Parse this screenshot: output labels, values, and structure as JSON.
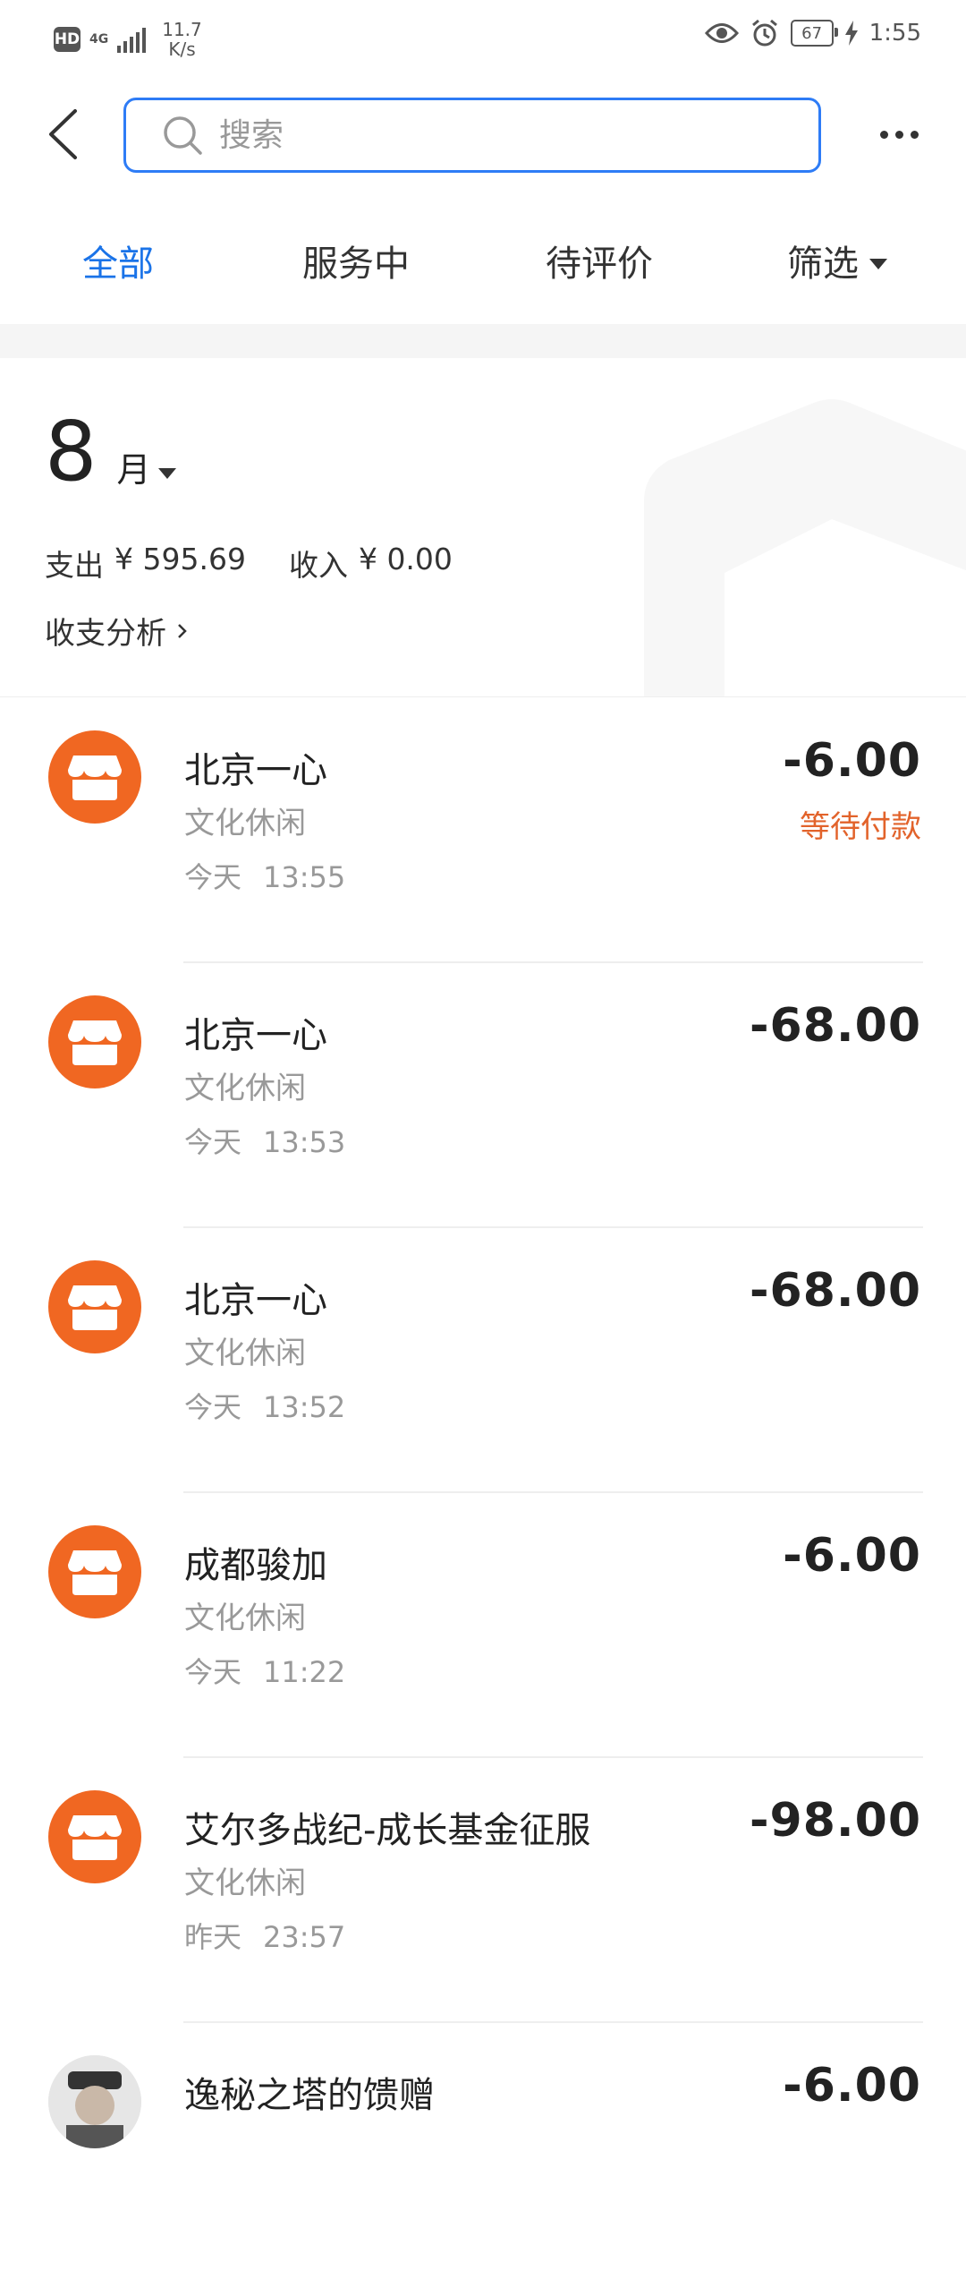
{
  "status_bar": {
    "hd": "HD",
    "network": "4G",
    "speed_value": "11.7",
    "speed_unit": "K/s",
    "battery": "67",
    "time": "1:55"
  },
  "header": {
    "search_placeholder": "搜索"
  },
  "tabs": [
    {
      "label": "全部",
      "active": true
    },
    {
      "label": "服务中",
      "active": false
    },
    {
      "label": "待评价",
      "active": false
    },
    {
      "label": "筛选",
      "active": false
    }
  ],
  "month": {
    "number": "8",
    "unit": "月",
    "expense_label": "支出",
    "expense_value": "¥ 595.69",
    "income_label": "收入",
    "income_value": "¥ 0.00",
    "analysis_label": "收支分析"
  },
  "colors": {
    "accent": "#1a73e8",
    "shop_icon": "#f06722",
    "pending": "#e2632b"
  },
  "transactions": [
    {
      "title": "北京一心",
      "category": "文化休闲",
      "day": "今天",
      "time": "13:55",
      "amount": "-6.00",
      "status": "等待付款",
      "icon": "shop-icon"
    },
    {
      "title": "北京一心",
      "category": "文化休闲",
      "day": "今天",
      "time": "13:53",
      "amount": "-68.00",
      "status": "",
      "icon": "shop-icon"
    },
    {
      "title": "北京一心",
      "category": "文化休闲",
      "day": "今天",
      "time": "13:52",
      "amount": "-68.00",
      "status": "",
      "icon": "shop-icon"
    },
    {
      "title": "成都骏加",
      "category": "文化休闲",
      "day": "今天",
      "time": "11:22",
      "amount": "-6.00",
      "status": "",
      "icon": "shop-icon"
    },
    {
      "title": "艾尔多战纪-成长基金征服",
      "category": "文化休闲",
      "day": "昨天",
      "time": "23:57",
      "amount": "-98.00",
      "status": "",
      "icon": "shop-icon"
    },
    {
      "title": "逸秘之塔的馈赠",
      "category": "",
      "day": "",
      "time": "",
      "amount": "-6.00",
      "status": "",
      "icon": "avatar"
    }
  ]
}
